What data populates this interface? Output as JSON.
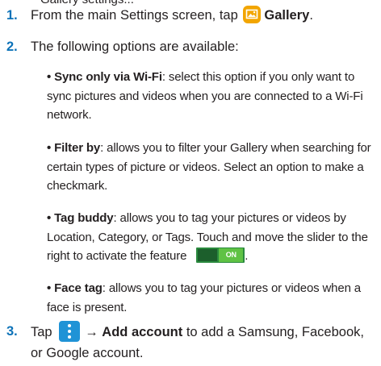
{
  "top_clip_text": "Gallery settings...",
  "steps": [
    {
      "number": "1.",
      "prefix": "From the main Settings screen, tap",
      "icon": "gallery-icon",
      "target": "Gallery",
      "suffix": "."
    },
    {
      "number": "2.",
      "text": "The following options are available:",
      "bullets": [
        {
          "term": "Sync only via Wi-Fi",
          "body": ": select this option if you only want to sync pictures and videos when you are connected to a Wi-Fi network."
        },
        {
          "term": "Filter by",
          "body": ": allows you to filter your Gallery when searching for certain types of picture or videos. Select an option to make a checkmark."
        },
        {
          "term": "Tag buddy",
          "body": ": allows you to tag your pictures or videos by Location, Category, or Tags. Touch and move the slider to the right to activate the feature",
          "toggle_label": "ON",
          "after_toggle": "."
        },
        {
          "term": "Face tag",
          "body": ": allows you to tag your pictures or videos when a face is present."
        }
      ]
    },
    {
      "number": "3.",
      "prefix": "Tap",
      "icon": "menu-icon",
      "arrow": "→",
      "target": "Add account",
      "suffix": "to add a Samsung, Facebook,",
      "continuation": "or Google account."
    }
  ],
  "colors": {
    "step_number": "#0c72b8",
    "gallery_icon": "#f2a500",
    "menu_icon": "#1f93d6",
    "toggle_on": "#5fc244"
  }
}
